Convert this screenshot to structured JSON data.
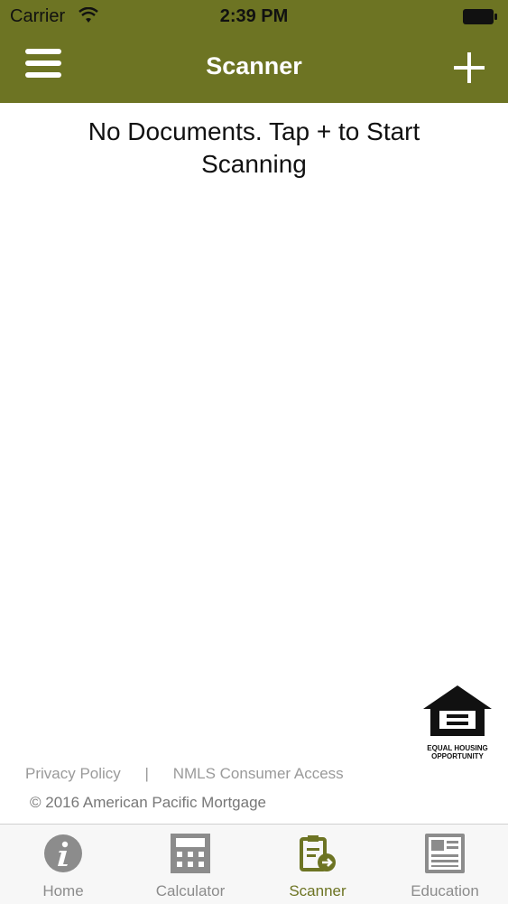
{
  "status": {
    "carrier": "Carrier",
    "time": "2:39 PM"
  },
  "nav": {
    "title": "Scanner",
    "menu_icon": "hamburger-menu-icon",
    "add_icon": "plus-icon"
  },
  "main": {
    "empty_message": "No Documents. Tap + to Start Scanning"
  },
  "logo": {
    "line1": "EQUAL HOUSING",
    "line2": "OPPORTUNITY"
  },
  "footer": {
    "privacy": "Privacy Policy",
    "separator": "|",
    "nmls": "NMLS Consumer Access",
    "copyright": "© 2016 American Pacific Mortgage"
  },
  "tabs": [
    {
      "label": "Home",
      "icon": "info-icon"
    },
    {
      "label": "Calculator",
      "icon": "calculator-icon"
    },
    {
      "label": "Scanner",
      "icon": "scanner-icon",
      "active": true
    },
    {
      "label": "Education",
      "icon": "newspaper-icon"
    }
  ],
  "colors": {
    "brand": "#6d7423",
    "tab_inactive": "#8c8c8c",
    "footer_text": "#9a9a9a"
  }
}
